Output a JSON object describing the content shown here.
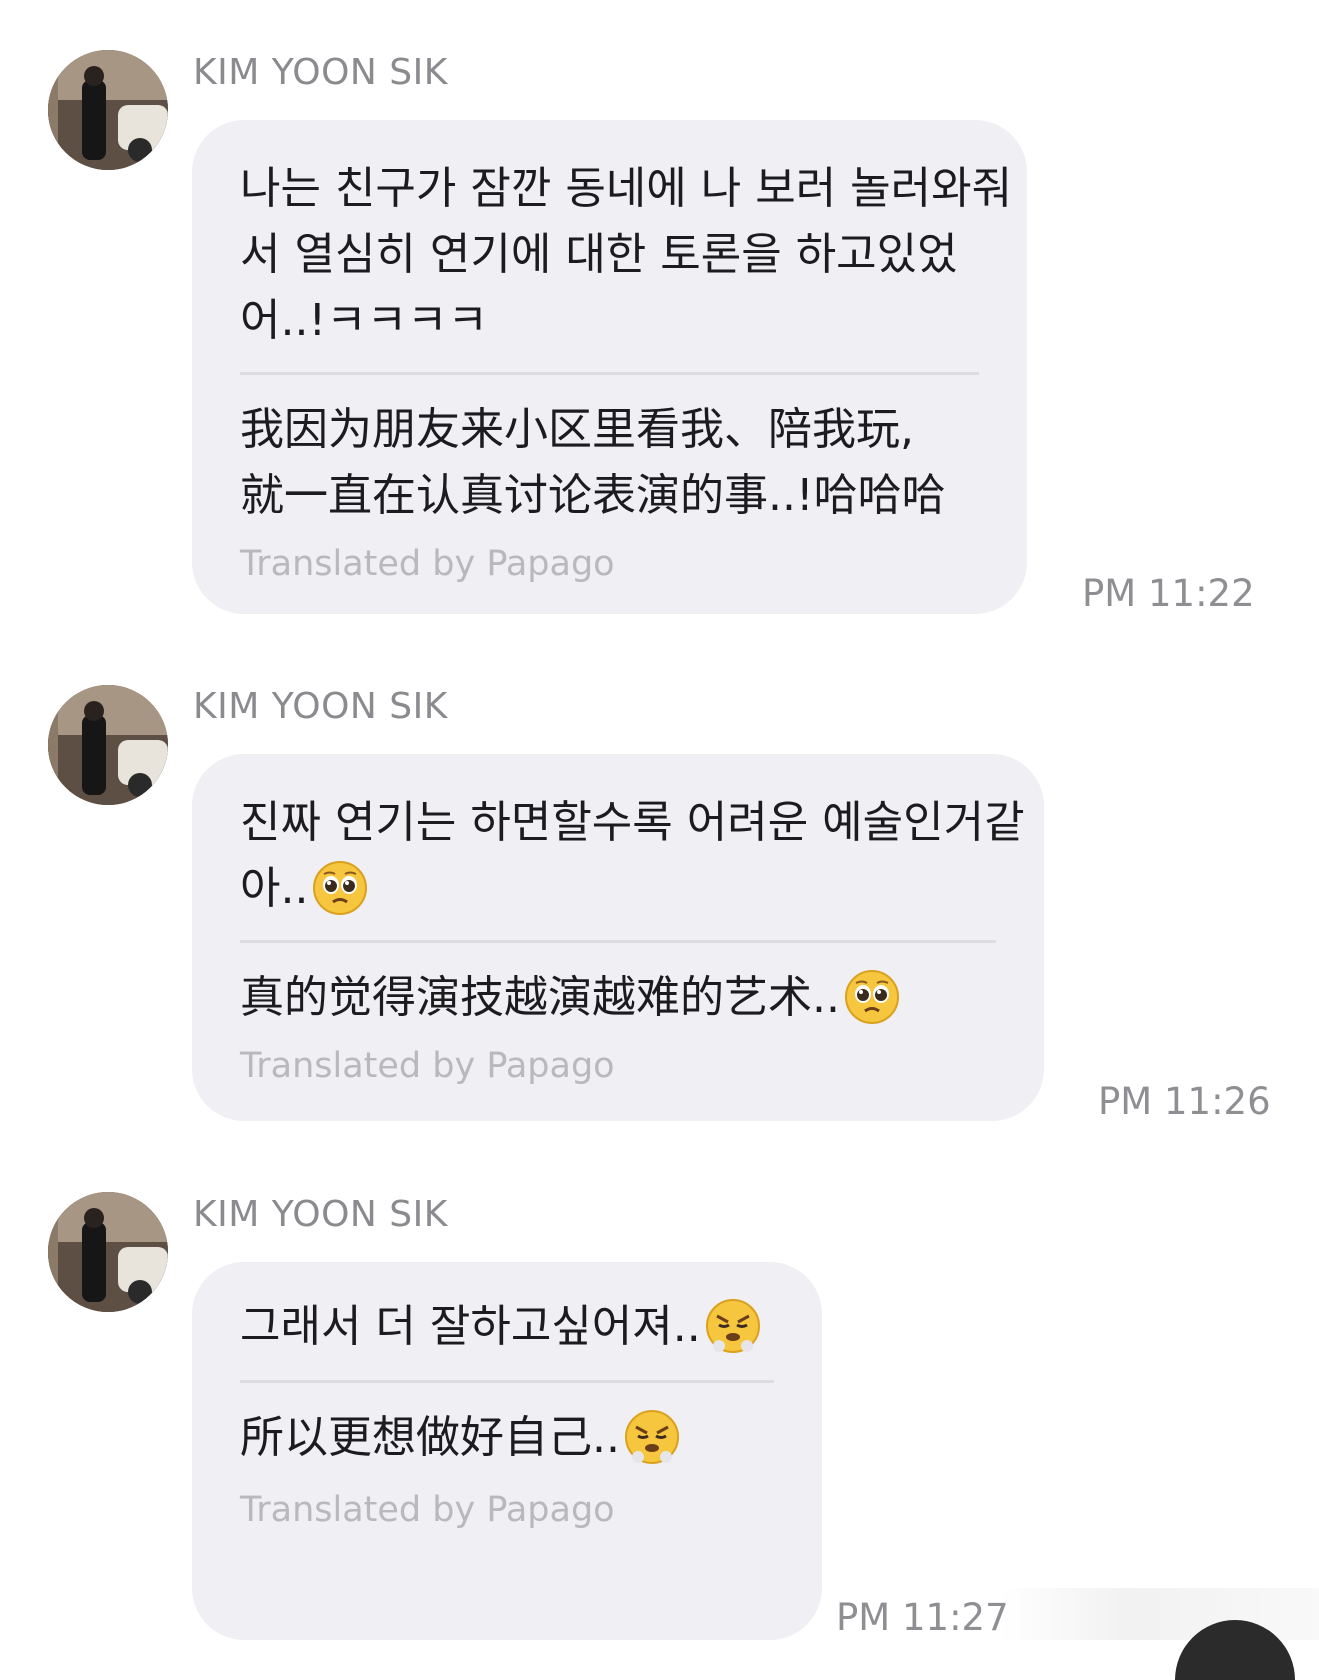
{
  "messages": [
    {
      "sender": "KIM YOON SIK",
      "original_lines": [
        "나는 친구가 잠깐 동네에 나 보러 놀러와줘",
        "서 열심히 연기에 대한 토론을 하고있었",
        "어..!ㅋㅋㅋㅋ"
      ],
      "translated_lines": [
        "我因为朋友来小区里看我、陪我玩,",
        "就一直在认真讨论表演的事..!哈哈哈"
      ],
      "credit": "Translated by Papago",
      "time": "PM 11:22",
      "emoji": null
    },
    {
      "sender": "KIM YOON SIK",
      "original_lines": [
        "진짜 연기는 하면할수록 어려운 예술인거같",
        "아.."
      ],
      "translated_lines": [
        "真的觉得演技越演越难的艺术.."
      ],
      "credit": "Translated by Papago",
      "time": "PM 11:26",
      "emoji": "pleading-face"
    },
    {
      "sender": "KIM YOON SIK",
      "original_lines": [
        "그래서 더 잘하고싶어져.."
      ],
      "translated_lines": [
        "所以更想做好自己.."
      ],
      "credit": "Translated by Papago",
      "time": "PM 11:27",
      "emoji": "steam-face"
    }
  ],
  "colors": {
    "bubble": "#efeff4",
    "sender": "#8a8a8f",
    "text": "#1c1c1e",
    "credit": "#b8b8bd",
    "time": "#8e8e93"
  }
}
